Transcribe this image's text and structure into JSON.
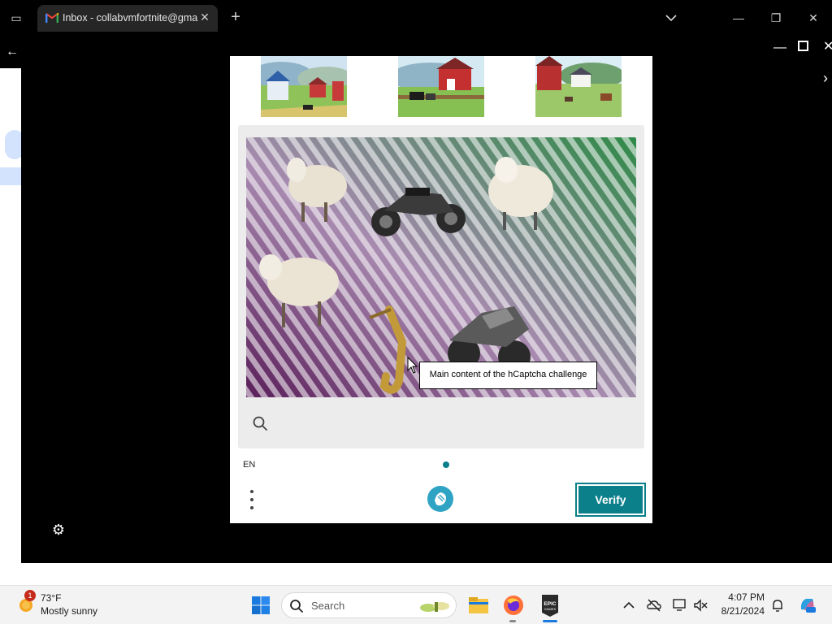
{
  "browser": {
    "tab_title": "Inbox - collabvmfortnite@gma",
    "new_tab_symbol": "+",
    "tab_close_symbol": "✕",
    "window_minimize_symbol": "—",
    "window_restore_symbol": "❐",
    "window_close_symbol": "✕"
  },
  "overlay": {
    "back_symbol": "←",
    "close_symbol": "✕",
    "next_symbol": "›",
    "settings_symbol": "⚙"
  },
  "captcha": {
    "example_images": [
      {
        "icon": "farm-barn-watercolor-image"
      },
      {
        "icon": "farm-barn-watercolor-image"
      },
      {
        "icon": "farm-barn-watercolor-image"
      }
    ],
    "challenge_image_icon": "sheep-motorcycles-saxophone-image",
    "language": "EN",
    "verify_label": "Verify",
    "tooltip": "Main content of the hCaptcha challenge",
    "accent_color": "#0b7f8a"
  },
  "taskbar": {
    "weather_temp": "73°F",
    "weather_desc": "Mostly sunny",
    "weather_badge": "1",
    "search_placeholder": "Search",
    "time": "4:07 PM",
    "date": "8/21/2024"
  }
}
